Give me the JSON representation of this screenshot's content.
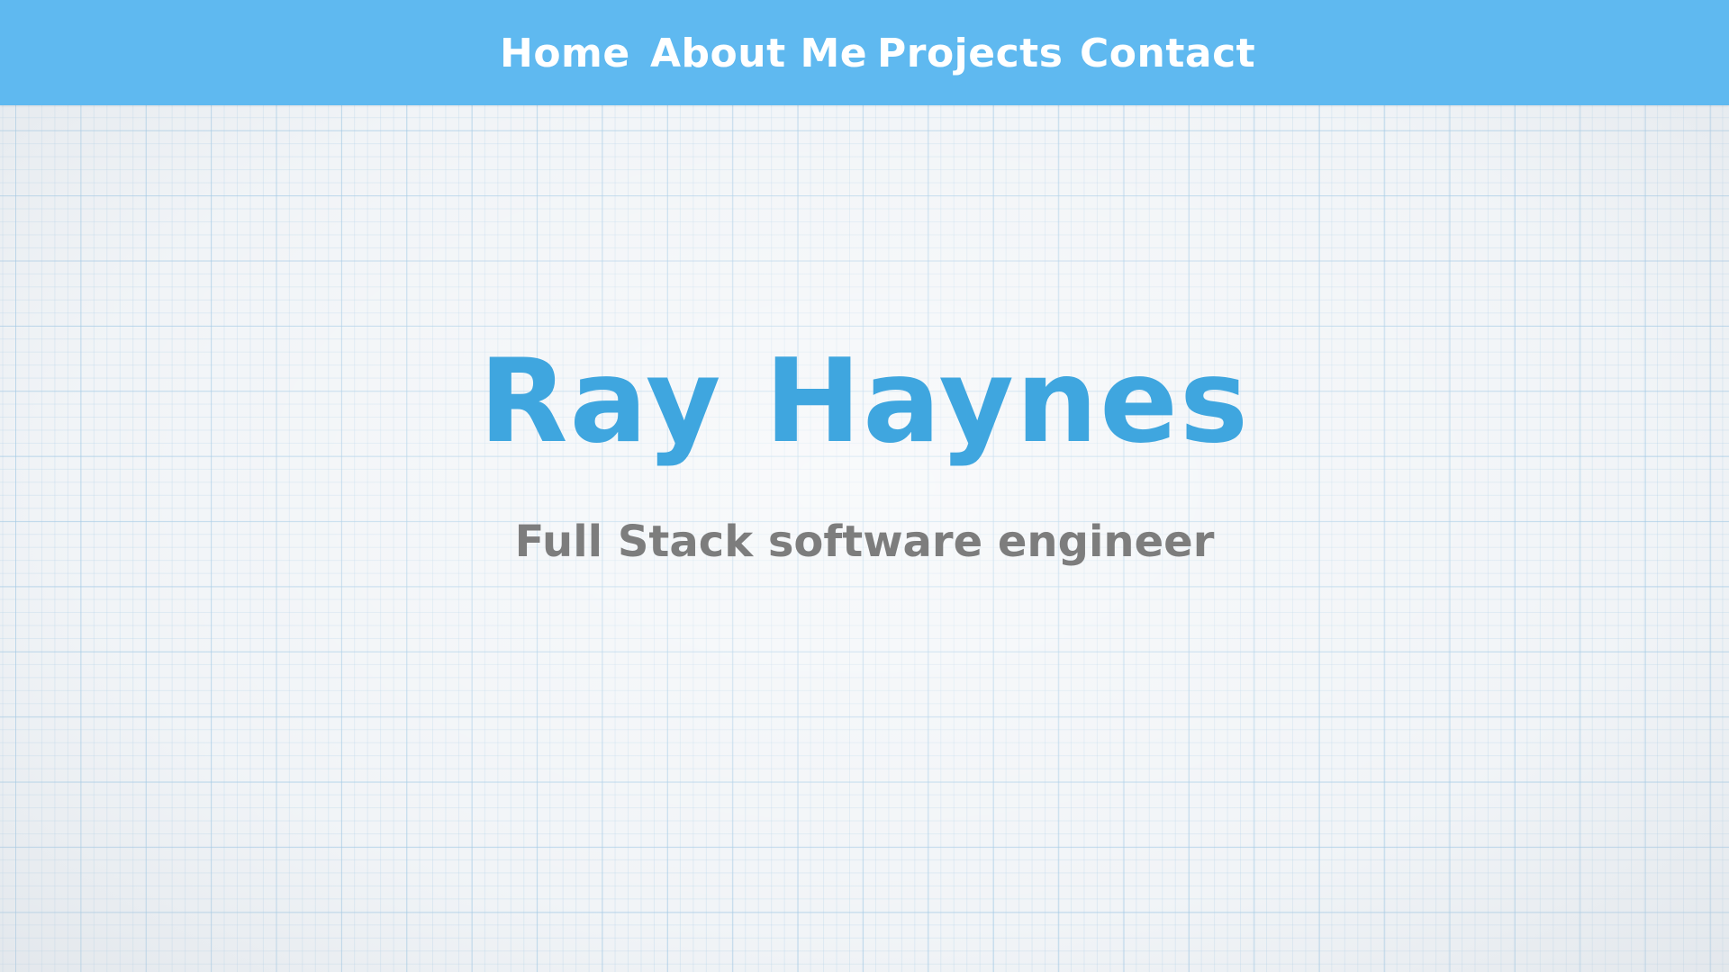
{
  "nav": {
    "items": [
      {
        "label": "Home"
      },
      {
        "label": "About Me"
      },
      {
        "label": "Projects"
      },
      {
        "label": "Contact"
      }
    ]
  },
  "hero": {
    "name": "Ray Haynes",
    "subtitle": "Full Stack software engineer"
  },
  "colors": {
    "navbar_background": "#5fb9f0",
    "nav_text": "#ffffff",
    "name_text": "#3fa6df",
    "subtitle_text": "#7d7d7d",
    "page_background": "#f1f4f7",
    "grid_lines": "#a0c8e4"
  }
}
